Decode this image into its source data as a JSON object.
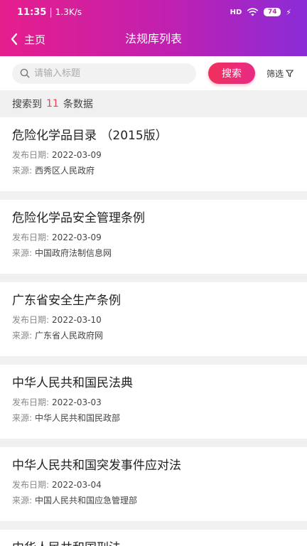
{
  "status_bar": {
    "time": "11:35",
    "speed": "1.3K/s",
    "signal": "HD",
    "battery": "74"
  },
  "nav": {
    "back_label": "主页",
    "title": "法规库列表"
  },
  "search": {
    "placeholder": "请输入标题",
    "button_label": "搜索",
    "filter_label": "筛选"
  },
  "result": {
    "prefix": "搜索到",
    "count": "11",
    "suffix": "条数据"
  },
  "labels": {
    "date": "发布日期:",
    "source": "来源:"
  },
  "items": [
    {
      "title": "危险化学品目录 （2015版）",
      "date": "2022-03-09",
      "source": "西秀区人民政府"
    },
    {
      "title": "危险化学品安全管理条例",
      "date": "2022-03-09",
      "source": "中国政府法制信息网"
    },
    {
      "title": "广东省安全生产条例",
      "date": "2022-03-10",
      "source": "广东省人民政府网"
    },
    {
      "title": "中华人民共和国民法典",
      "date": "2022-03-03",
      "source": "中华人民共和国民政部"
    },
    {
      "title": "中华人民共和国突发事件应对法",
      "date": "2022-03-04",
      "source": "中国人民共和国应急管理部"
    },
    {
      "title": "中华人民共和国刑法",
      "date": "",
      "source": ""
    }
  ]
}
